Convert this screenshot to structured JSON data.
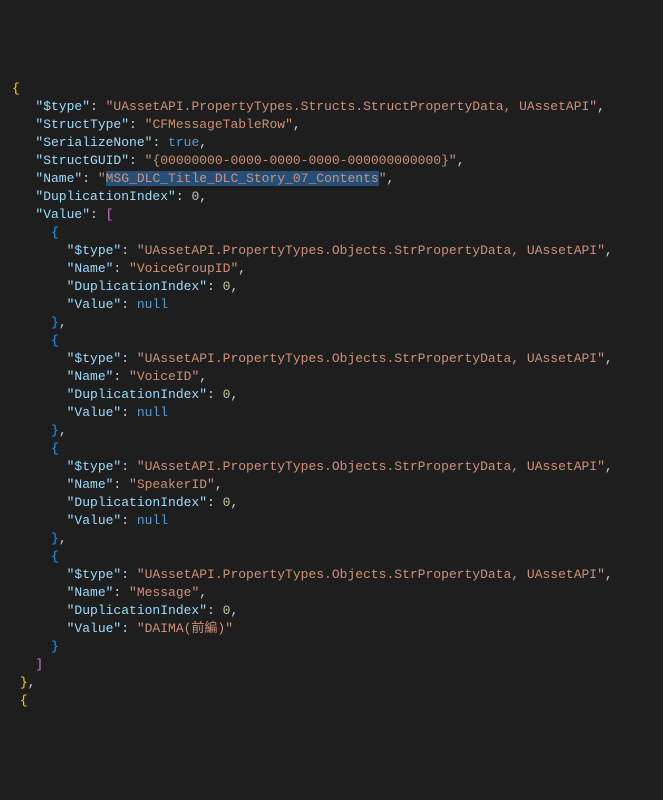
{
  "lines": {
    "l0": "{",
    "l1_key": "\"$type\"",
    "l1_val": "\"UAssetAPI.PropertyTypes.Structs.StructPropertyData, UAssetAPI\"",
    "l2_key": "\"StructType\"",
    "l2_val": "\"CFMessageTableRow\"",
    "l3_key": "\"SerializeNone\"",
    "l3_val": "true",
    "l4_key": "\"StructGUID\"",
    "l4_val": "\"{00000000-0000-0000-0000-000000000000}\"",
    "l5_key": "\"Name\"",
    "l5_val_open": "\"",
    "l5_val_sel": "MSG_DLC_Title_DLC_Story_07_Contents",
    "l5_val_close": "\"",
    "l6_key": "\"DuplicationIndex\"",
    "l6_val": "0",
    "l7_key": "\"Value\"",
    "obj1_type_key": "\"$type\"",
    "obj1_type_val": "\"UAssetAPI.PropertyTypes.Objects.StrPropertyData, UAssetAPI\"",
    "obj1_name_key": "\"Name\"",
    "obj1_name_val": "\"VoiceGroupID\"",
    "obj1_dup_key": "\"DuplicationIndex\"",
    "obj1_dup_val": "0",
    "obj1_val_key": "\"Value\"",
    "obj1_val_val": "null",
    "obj2_type_key": "\"$type\"",
    "obj2_type_val": "\"UAssetAPI.PropertyTypes.Objects.StrPropertyData, UAssetAPI\"",
    "obj2_name_key": "\"Name\"",
    "obj2_name_val": "\"VoiceID\"",
    "obj2_dup_key": "\"DuplicationIndex\"",
    "obj2_dup_val": "0",
    "obj2_val_key": "\"Value\"",
    "obj2_val_val": "null",
    "obj3_type_key": "\"$type\"",
    "obj3_type_val": "\"UAssetAPI.PropertyTypes.Objects.StrPropertyData, UAssetAPI\"",
    "obj3_name_key": "\"Name\"",
    "obj3_name_val": "\"SpeakerID\"",
    "obj3_dup_key": "\"DuplicationIndex\"",
    "obj3_dup_val": "0",
    "obj3_val_key": "\"Value\"",
    "obj3_val_val": "null",
    "obj4_type_key": "\"$type\"",
    "obj4_type_val": "\"UAssetAPI.PropertyTypes.Objects.StrPropertyData, UAssetAPI\"",
    "obj4_name_key": "\"Name\"",
    "obj4_name_val": "\"Message\"",
    "obj4_dup_key": "\"DuplicationIndex\"",
    "obj4_dup_val": "0",
    "obj4_val_key": "\"Value\"",
    "obj4_val_val": "\"DAIMA(前編)\""
  }
}
